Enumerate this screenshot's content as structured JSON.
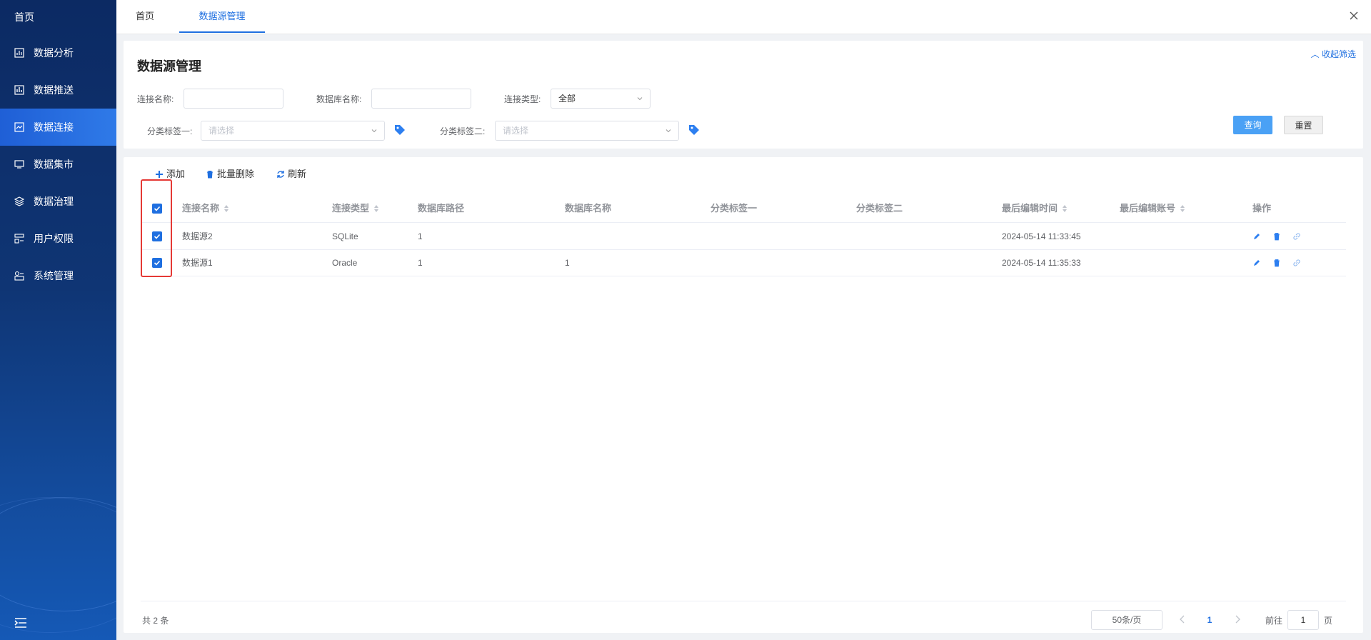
{
  "sidebar": {
    "home": "首页",
    "items": [
      {
        "label": "数据分析",
        "icon": "chart-icon"
      },
      {
        "label": "数据推送",
        "icon": "bar-chart-icon"
      },
      {
        "label": "数据连接",
        "icon": "connection-icon",
        "active": true
      },
      {
        "label": "数据集市",
        "icon": "monitor-icon"
      },
      {
        "label": "数据治理",
        "icon": "layers-icon"
      },
      {
        "label": "用户权限",
        "icon": "user-permission-icon"
      },
      {
        "label": "系统管理",
        "icon": "system-icon"
      }
    ]
  },
  "tabs": {
    "home": "首页",
    "active": "数据源管理"
  },
  "filter": {
    "title": "数据源管理",
    "collapse": "收起筛选",
    "conn_name_label": "连接名称:",
    "conn_name_value": "",
    "db_name_label": "数据库名称:",
    "db_name_value": "",
    "conn_type_label": "连接类型:",
    "conn_type_value": "全部",
    "tag1_label": "分类标签一:",
    "tag1_placeholder": "请选择",
    "tag2_label": "分类标签二:",
    "tag2_placeholder": "请选择",
    "query": "查询",
    "reset": "重置"
  },
  "toolbar": {
    "add": "添加",
    "batch_delete": "批量删除",
    "refresh": "刷新"
  },
  "table": {
    "columns": [
      "连接名称",
      "连接类型",
      "数据库路径",
      "数据库名称",
      "分类标签一",
      "分类标签二",
      "最后编辑时间",
      "最后编辑账号",
      "操作"
    ],
    "rows": [
      {
        "name": "数据源2",
        "type": "SQLite",
        "path": "1",
        "db": "",
        "tag1": "",
        "tag2": "",
        "time": "2024-05-14 11:33:45",
        "account": "",
        "checked": true
      },
      {
        "name": "数据源1",
        "type": "Oracle",
        "path": "1",
        "db": "1",
        "tag1": "",
        "tag2": "",
        "time": "2024-05-14 11:35:33",
        "account": "",
        "checked": true
      }
    ]
  },
  "pagination": {
    "total": "共 2 条",
    "page_size": "50条/页",
    "current": "1",
    "goto_prefix": "前往",
    "goto_value": "1",
    "goto_suffix": "页"
  },
  "colors": {
    "sidebar": "#0f3574",
    "accent": "#1f6fe0",
    "highlight": "#e53935"
  }
}
